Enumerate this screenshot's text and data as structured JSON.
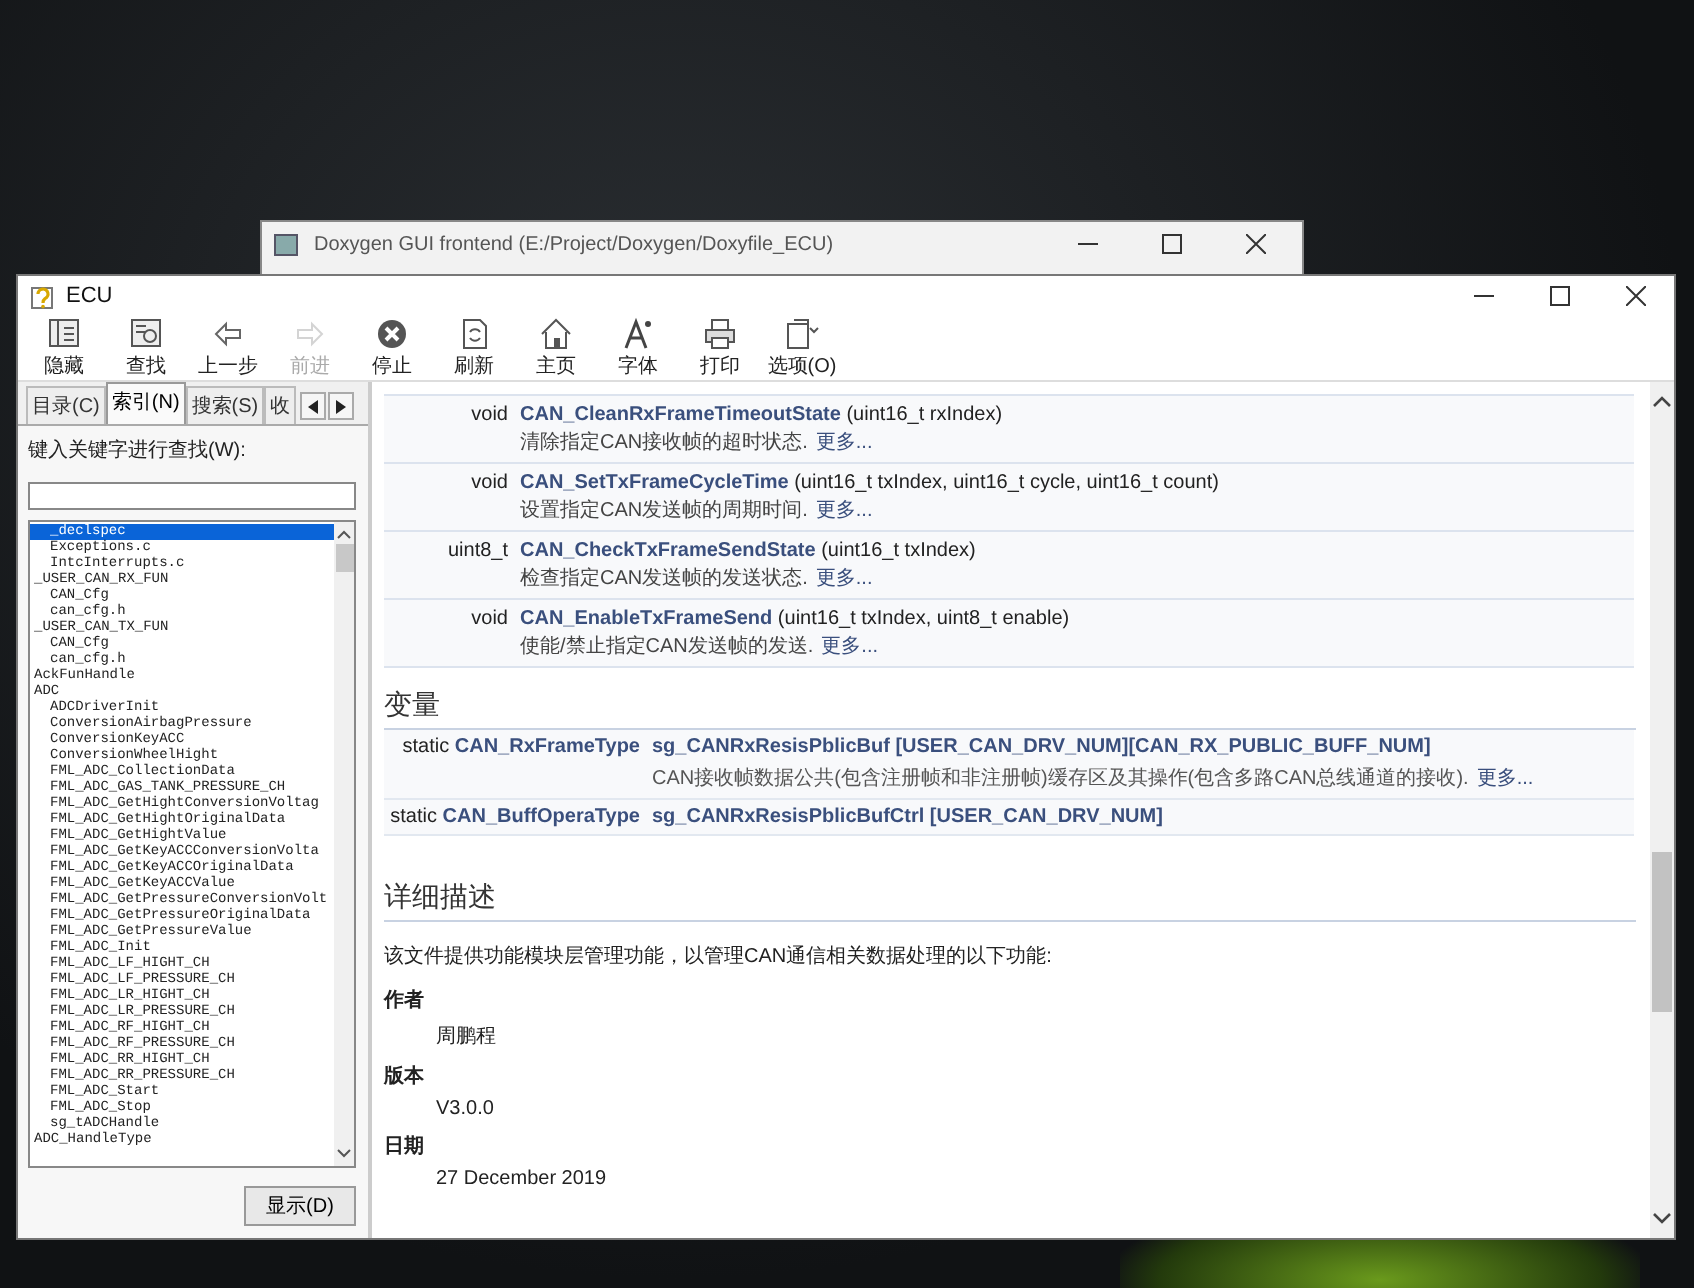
{
  "back_window": {
    "title": "Doxygen GUI frontend (E:/Project/Doxygen/Doxyfile_ECU)"
  },
  "window": {
    "title": "ECU"
  },
  "toolbar": [
    {
      "label": "隐藏",
      "disabled": false
    },
    {
      "label": "查找",
      "disabled": false
    },
    {
      "label": "上一步",
      "disabled": false
    },
    {
      "label": "前进",
      "disabled": true
    },
    {
      "label": "停止",
      "disabled": false
    },
    {
      "label": "刷新",
      "disabled": false
    },
    {
      "label": "主页",
      "disabled": false
    },
    {
      "label": "字体",
      "disabled": false
    },
    {
      "label": "打印",
      "disabled": false
    },
    {
      "label": "选项(O)",
      "disabled": false
    }
  ],
  "sidebar": {
    "tabs": [
      {
        "label": "目录(C)",
        "selected": false
      },
      {
        "label": "索引(N)",
        "selected": true
      },
      {
        "label": "搜索(S)",
        "selected": false
      },
      {
        "label": "收",
        "selected": false
      }
    ],
    "search_label": "键入关键字进行查找(W):",
    "index": {
      "leading_items": [
        {
          "label": "_declspec",
          "selected": true
        },
        {
          "label": "Exceptions.c",
          "selected": false
        },
        {
          "label": "IntcInterrupts.c",
          "selected": false
        }
      ],
      "items": [
        {
          "label": "_USER_CAN_RX_FUN",
          "selected": false,
          "children": [
            {
              "label": "CAN_Cfg",
              "selected": false
            },
            {
              "label": "can_cfg.h",
              "selected": false
            }
          ]
        },
        {
          "label": "_USER_CAN_TX_FUN",
          "selected": false,
          "children": [
            {
              "label": "CAN_Cfg",
              "selected": false
            },
            {
              "label": "can_cfg.h",
              "selected": false
            }
          ]
        },
        {
          "label": "AckFunHandle",
          "selected": false
        },
        {
          "label": "ADC",
          "selected": false,
          "children": [
            {
              "label": "ADCDriverInit",
              "selected": false
            },
            {
              "label": "ConversionAirbagPressure",
              "selected": false
            },
            {
              "label": "ConversionKeyACC",
              "selected": false
            },
            {
              "label": "ConversionWheelHight",
              "selected": false
            },
            {
              "label": "FML_ADC_CollectionData",
              "selected": false
            },
            {
              "label": "FML_ADC_GAS_TANK_PRESSURE_CH",
              "selected": false
            },
            {
              "label": "FML_ADC_GetHightConversionVoltag",
              "selected": false
            },
            {
              "label": "FML_ADC_GetHightOriginalData",
              "selected": false
            },
            {
              "label": "FML_ADC_GetHightValue",
              "selected": false
            },
            {
              "label": "FML_ADC_GetKeyACCConversionVolta",
              "selected": false
            },
            {
              "label": "FML_ADC_GetKeyACCOriginalData",
              "selected": false
            },
            {
              "label": "FML_ADC_GetKeyACCValue",
              "selected": false
            },
            {
              "label": "FML_ADC_GetPressureConversionVolt",
              "selected": false
            },
            {
              "label": "FML_ADC_GetPressureOriginalData",
              "selected": false
            },
            {
              "label": "FML_ADC_GetPressureValue",
              "selected": false
            },
            {
              "label": "FML_ADC_Init",
              "selected": false
            },
            {
              "label": "FML_ADC_LF_HIGHT_CH",
              "selected": false
            },
            {
              "label": "FML_ADC_LF_PRESSURE_CH",
              "selected": false
            },
            {
              "label": "FML_ADC_LR_HIGHT_CH",
              "selected": false
            },
            {
              "label": "FML_ADC_LR_PRESSURE_CH",
              "selected": false
            },
            {
              "label": "FML_ADC_RF_HIGHT_CH",
              "selected": false
            },
            {
              "label": "FML_ADC_RF_PRESSURE_CH",
              "selected": false
            },
            {
              "label": "FML_ADC_RR_HIGHT_CH",
              "selected": false
            },
            {
              "label": "FML_ADC_RR_PRESSURE_CH",
              "selected": false
            },
            {
              "label": "FML_ADC_Start",
              "selected": false
            },
            {
              "label": "FML_ADC_Stop",
              "selected": false
            },
            {
              "label": "sg_tADCHandle",
              "selected": false
            }
          ]
        },
        {
          "label": "ADC_HandleType",
          "selected": false
        }
      ]
    },
    "display_button": "显示(D)"
  },
  "content": {
    "functions": [
      {
        "type": "void",
        "name": "CAN_CleanRxFrameTimeoutState",
        "params": "(uint16_t rxIndex)",
        "brief": "清除指定CAN接收帧的超时状态.",
        "more": "更多..."
      },
      {
        "type": "void",
        "name": "CAN_SetTxFrameCycleTime",
        "params": "(uint16_t txIndex, uint16_t cycle, uint16_t count)",
        "brief": "设置指定CAN发送帧的周期时间.",
        "more": "更多..."
      },
      {
        "type": "uint8_t",
        "name": "CAN_CheckTxFrameSendState",
        "params": "(uint16_t txIndex)",
        "brief": "检查指定CAN发送帧的发送状态.",
        "more": "更多..."
      },
      {
        "type": "void",
        "name": "CAN_EnableTxFrameSend",
        "params": "(uint16_t txIndex, uint8_t enable)",
        "brief": "使能/禁止指定CAN发送帧的发送.",
        "more": "更多..."
      }
    ],
    "variables_heading": "变量",
    "variables": [
      {
        "qualifier": "static",
        "type": "CAN_RxFrameType",
        "name": "sg_CANRxResisPblicBuf [USER_CAN_DRV_NUM][CAN_RX_PUBLIC_BUFF_NUM]",
        "brief": "CAN接收帧数据公共(包含注册帧和非注册帧)缓存区及其操作(包含多路CAN总线通道的接收).",
        "more": "更多..."
      },
      {
        "qualifier": "static",
        "type": "CAN_BuffOperaType",
        "name": "sg_CANRxResisPblicBufCtrl [USER_CAN_DRV_NUM]"
      }
    ],
    "detail_heading": "详细描述",
    "detail_text": "该文件提供功能模块层管理功能，以管理CAN通信相关数据处理的以下功能:",
    "fields": [
      {
        "term": "作者",
        "value": "周鹏程"
      },
      {
        "term": "版本",
        "value": "V3.0.0"
      },
      {
        "term": "日期",
        "value": "27 December 2019"
      }
    ]
  }
}
